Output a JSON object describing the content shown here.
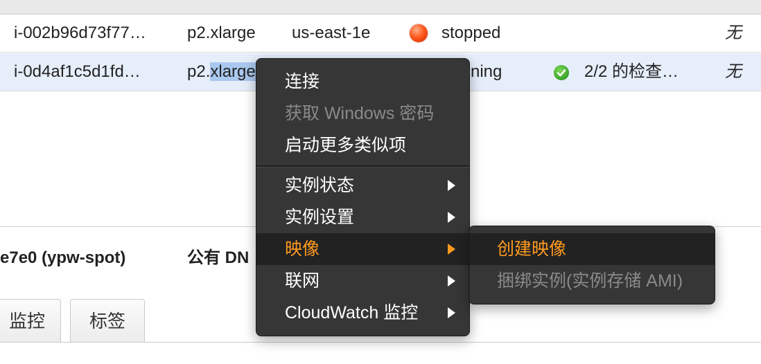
{
  "table": {
    "rows": [
      {
        "instance_id": "i-002b96d73f77…",
        "instance_type": "p2.xlarge",
        "availability_zone": "us-east-1e",
        "state": "stopped",
        "status_checks": "",
        "alarm": "无",
        "state_color": "#ff5a1f"
      },
      {
        "instance_id": "i-0d4af1c5d1fd…",
        "instance_type_prefix": "p2.",
        "instance_type_selected": "xlarge",
        "state_partial": "ning",
        "status_checks": "2/2 的检查…",
        "alarm": "无",
        "check_color": "#3aa12a"
      }
    ]
  },
  "details": {
    "instance_name": "e7e0 (ypw-spot)",
    "public_dns_label": "公有 DN",
    "tabs": [
      {
        "label": "监控"
      },
      {
        "label": "标签"
      }
    ]
  },
  "context_menu": {
    "items": [
      {
        "label": "连接",
        "enabled": true
      },
      {
        "label": "获取 Windows 密码",
        "enabled": false
      },
      {
        "label": "启动更多类似项",
        "enabled": true
      },
      {
        "label": "实例状态",
        "enabled": true,
        "has_submenu": true
      },
      {
        "label": "实例设置",
        "enabled": true,
        "has_submenu": true
      },
      {
        "label": "映像",
        "enabled": true,
        "has_submenu": true,
        "active": true
      },
      {
        "label": "联网",
        "enabled": true,
        "has_submenu": true
      },
      {
        "label": "CloudWatch 监控",
        "enabled": true,
        "has_submenu": true
      }
    ],
    "active_color": "#ff9a1f"
  },
  "submenu": {
    "items": [
      {
        "label": "创建映像",
        "enabled": true,
        "active": true
      },
      {
        "label": "捆绑实例(实例存储 AMI)",
        "enabled": false
      }
    ]
  }
}
